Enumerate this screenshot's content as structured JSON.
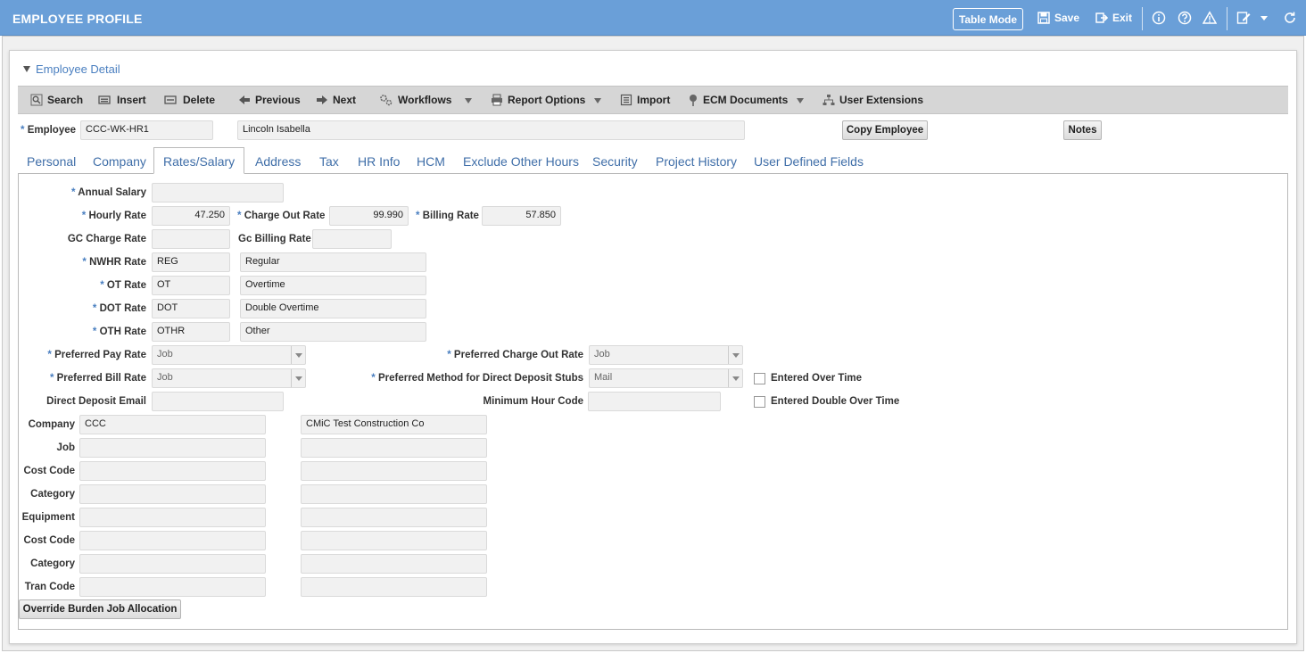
{
  "header": {
    "title": "EMPLOYEE PROFILE",
    "table_mode": "Table Mode",
    "save": "Save",
    "exit": "Exit"
  },
  "section": {
    "title": "Employee Detail"
  },
  "toolbar": {
    "search": "Search",
    "insert": "Insert",
    "delete": "Delete",
    "previous": "Previous",
    "next": "Next",
    "workflows": "Workflows",
    "report_options": "Report Options",
    "import": "Import",
    "ecm_documents": "ECM Documents",
    "user_extensions": "User Extensions"
  },
  "employee": {
    "label": "Employee",
    "code": "CCC-WK-HR1",
    "name": "Lincoln Isabella",
    "copy_button": "Copy Employee",
    "notes_button": "Notes"
  },
  "tabs": [
    "Personal",
    "Company",
    "Rates/Salary",
    "Address",
    "Tax",
    "HR Info",
    "HCM",
    "Exclude Other Hours",
    "Security",
    "Project History",
    "User Defined Fields"
  ],
  "rates": {
    "annual_salary": {
      "label": "Annual Salary",
      "value": ""
    },
    "hourly_rate": {
      "label": "Hourly Rate",
      "value": "47.250"
    },
    "charge_out_rate": {
      "label": "Charge Out Rate",
      "value": "99.990"
    },
    "billing_rate": {
      "label": "Billing Rate",
      "value": "57.850"
    },
    "gc_charge_rate": {
      "label": "GC Charge Rate",
      "value": ""
    },
    "gc_billing_rate": {
      "label": "Gc Billing Rate",
      "value": ""
    },
    "nwhr_rate": {
      "label": "NWHR Rate",
      "code": "REG",
      "desc": "Regular"
    },
    "ot_rate": {
      "label": "OT Rate",
      "code": "OT",
      "desc": "Overtime"
    },
    "dot_rate": {
      "label": "DOT Rate",
      "code": "DOT",
      "desc": "Double Overtime"
    },
    "oth_rate": {
      "label": "OTH Rate",
      "code": "OTHR",
      "desc": "Other"
    },
    "preferred_pay_rate": {
      "label": "Preferred Pay Rate",
      "value": "Job"
    },
    "preferred_charge_out_rate": {
      "label": "Preferred Charge Out Rate",
      "value": "Job"
    },
    "preferred_bill_rate": {
      "label": "Preferred Bill Rate",
      "value": "Job"
    },
    "preferred_method_dd": {
      "label": "Preferred Method for Direct Deposit Stubs",
      "value": "Mail"
    },
    "entered_over_time": "Entered Over Time",
    "entered_double_over_time": "Entered Double Over Time",
    "direct_deposit_email": {
      "label": "Direct Deposit Email",
      "value": ""
    },
    "minimum_hour_code": {
      "label": "Minimum Hour Code",
      "value": ""
    }
  },
  "allocation": {
    "company": {
      "label": "Company",
      "code": "CCC",
      "desc": "CMiC Test Construction Co"
    },
    "job": {
      "label": "Job",
      "code": "",
      "desc": ""
    },
    "cost_code": {
      "label": "Cost Code",
      "code": "",
      "desc": ""
    },
    "category": {
      "label": "Category",
      "code": "",
      "desc": ""
    },
    "equipment": {
      "label": "Equipment",
      "code": "",
      "desc": ""
    },
    "cost_code_2": {
      "label": "Cost Code",
      "code": "",
      "desc": ""
    },
    "category_2": {
      "label": "Category",
      "code": "",
      "desc": ""
    },
    "tran_code": {
      "label": "Tran Code",
      "code": "",
      "desc": ""
    },
    "override_button": "Override Burden Job Allocation"
  },
  "colors": {
    "header_bg": "#6a9fd8",
    "link": "#3f6ea8",
    "toolbar_bg": "#d6d6d6"
  }
}
